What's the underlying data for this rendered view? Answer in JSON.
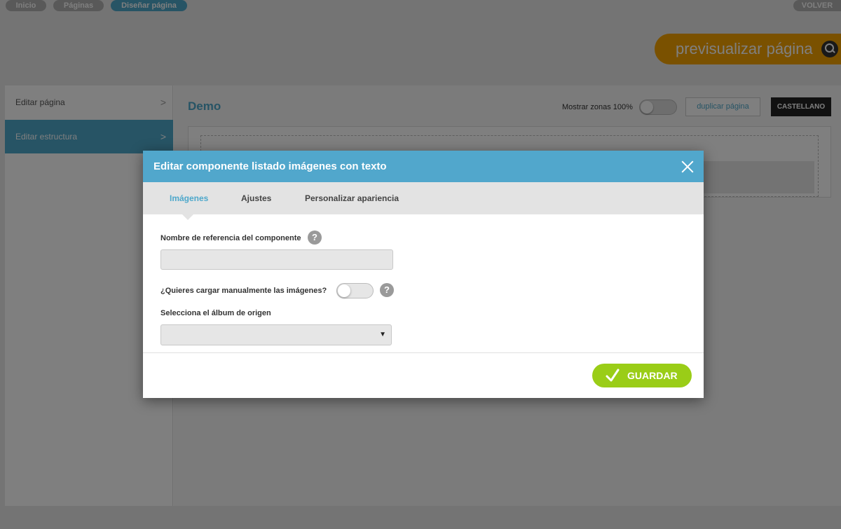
{
  "topbar": {
    "breadcrumbs": [
      {
        "label": "Inicio"
      },
      {
        "label": "Páginas"
      },
      {
        "label": "Diseñar página"
      }
    ],
    "back_label": "VOLVER"
  },
  "preview": {
    "label": "previsualizar página",
    "icon": "search-icon"
  },
  "sidebar": {
    "items": [
      {
        "label": "Editar página"
      },
      {
        "label": "Editar estructura"
      }
    ]
  },
  "content": {
    "page_title": "Demo",
    "zones_label": "Mostrar zonas 100%",
    "duplicate_label": "duplicar página",
    "language_label": "CASTELLANO"
  },
  "modal": {
    "title": "Editar componente listado imágenes con texto",
    "tabs": [
      {
        "label": "Imágenes"
      },
      {
        "label": "Ajustes"
      },
      {
        "label": "Personalizar apariencia"
      }
    ],
    "fields": {
      "ref_name_label": "Nombre de referencia del componente",
      "ref_name_value": "",
      "manual_label": "¿Quieres cargar manualmente las imágenes?",
      "album_label": "Selecciona el álbum de origen",
      "album_value": ""
    },
    "help_glyph": "?",
    "save_label": "GUARDAR"
  },
  "colors": {
    "accent": "#51a7cc",
    "save": "#9acd17",
    "preview": "#f5a300"
  }
}
